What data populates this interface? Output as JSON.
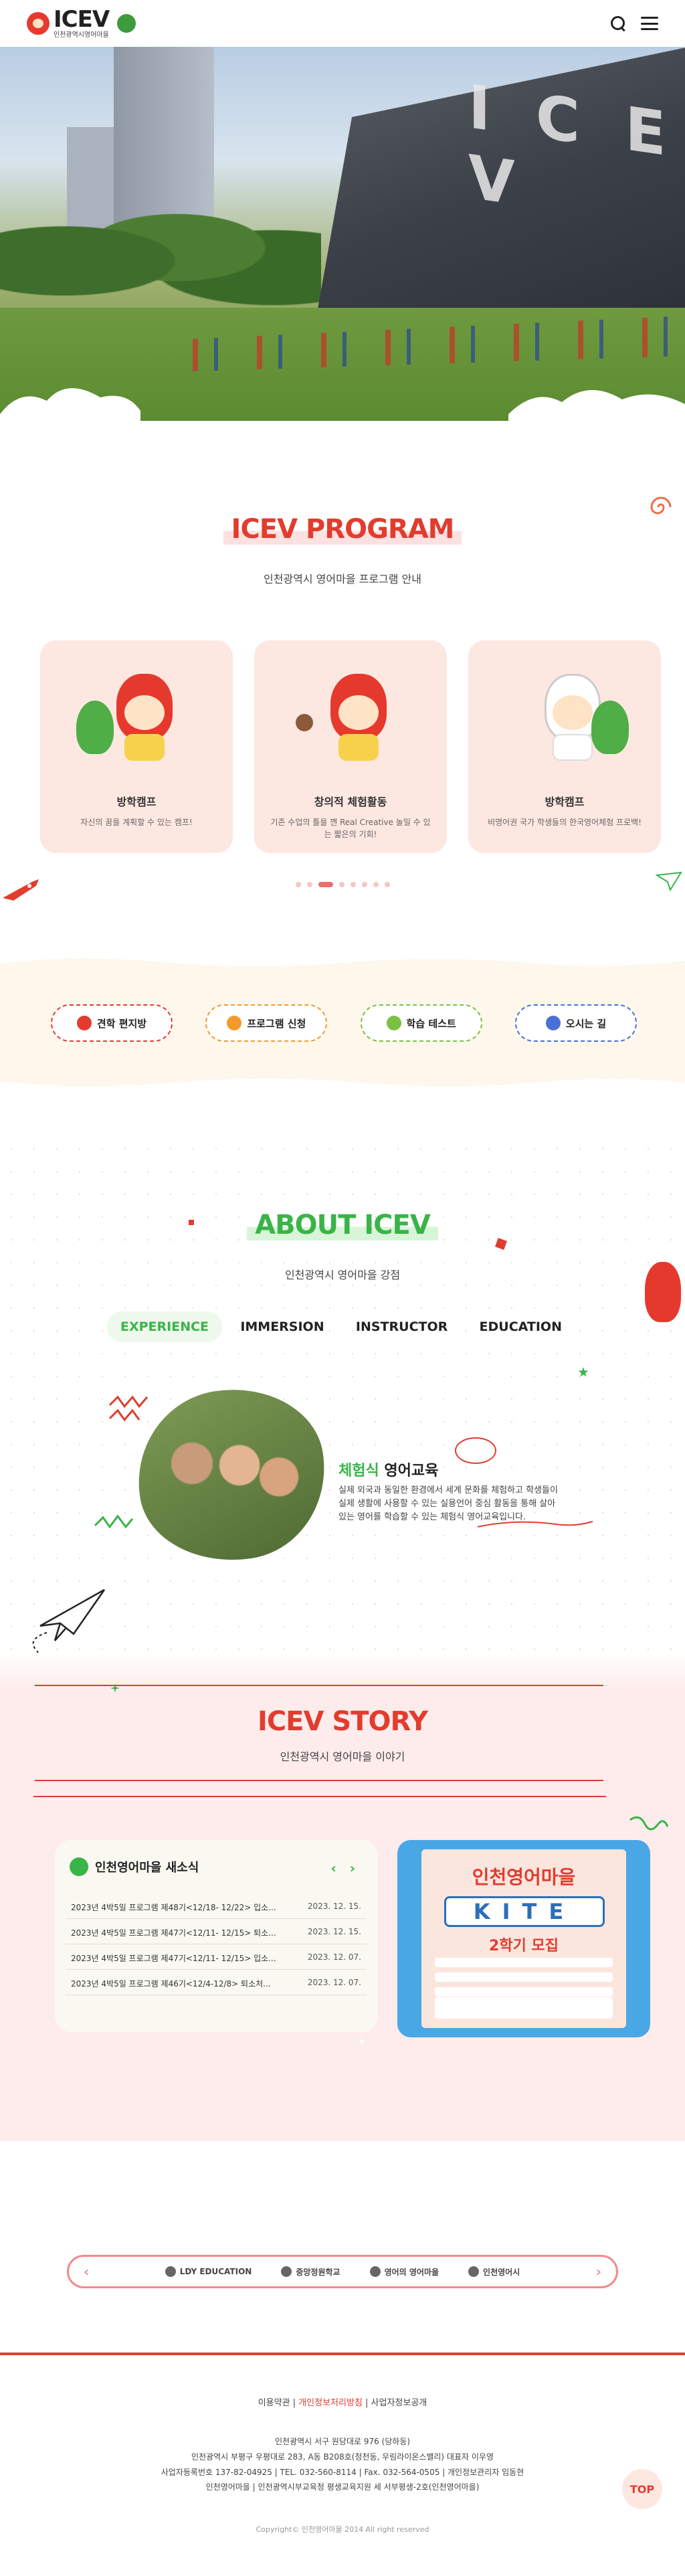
{
  "header": {
    "logo_word": "ICEV",
    "logo_sub": "인천광역시영어마을",
    "icons": [
      "search-icon",
      "menu-icon"
    ]
  },
  "hero": {
    "building_sign": "I C E V"
  },
  "program": {
    "title": "ICEV PROGRAM",
    "subtitle": "인천광역시 영어마을 프로그램 안내",
    "cards": [
      {
        "title": "방학캠프",
        "desc": "자신의 꿈을 계획할 수 있는 캠프!"
      },
      {
        "title": "창의적 체험활동",
        "desc": "기존 수업의 틀을 깬 Real Creative 놀일 수 있는 짧은의 기회!"
      },
      {
        "title": "방학캠프",
        "desc": "비영어권 국가 학생들의 한국영어체험 프로백!"
      }
    ],
    "dot_count": 8,
    "active_dot": 2
  },
  "quick_links": [
    {
      "label": "견학 편지방",
      "color": "#e23c2f"
    },
    {
      "label": "프로그램 신청",
      "color": "#f39a2b"
    },
    {
      "label": "학습 테스트",
      "color": "#7ac143"
    },
    {
      "label": "오시는 길",
      "color": "#4a6fd6"
    }
  ],
  "about": {
    "title": "ABOUT ICEV",
    "subtitle": "인천광역시 영어마을 강점",
    "tabs": [
      "EXPERIENCE",
      "IMMERSION",
      "INSTRUCTOR",
      "EDUCATION"
    ],
    "active_tab": 0,
    "headline_em": "체험식",
    "headline_rest": " 영어교육",
    "body": "실제 외국과 동일한 환경에서 세계 문화를 체험하고 학생들이 실제 생활에 사용할 수 있는 실용언어 중심 활동을 통해 살아있는 영어를 학습할 수 있는 체험식 영어교육입니다."
  },
  "story": {
    "title": "ICEV STORY",
    "subtitle": "인천광역시 영어마을 이야기",
    "news_title": "인천영어마을 새소식",
    "news": [
      {
        "title": "2023년 4박5일 프로그램 제48기<12/18- 12/22> 입소...",
        "date": "2023. 12. 15."
      },
      {
        "title": "2023년 4박5일 프로그램 제47기<12/11- 12/15> 퇴소...",
        "date": "2023. 12. 15."
      },
      {
        "title": "2023년 4박5일 프로그램 제47기<12/11- 12/15> 입소...",
        "date": "2023. 12. 07."
      },
      {
        "title": "2023년 4박5일 프로그램 제46기<12/4-12/8> 퇴소처...",
        "date": "2023. 12. 07."
      }
    ],
    "poster": {
      "tag": "KITE 모집",
      "title": "인천영어마을",
      "kite": "KITE",
      "sub": "2학기 모집"
    }
  },
  "partners": [
    "LDY EDUCATION",
    "중앙정원학교",
    "영어의 영어마을",
    "인천영어시"
  ],
  "footer": {
    "links": [
      {
        "label": "이용약관",
        "hot": false
      },
      {
        "label": "개인정보처리방침",
        "hot": true
      },
      {
        "label": "사업자정보공개",
        "hot": false
      }
    ],
    "info": [
      "인천광역시 서구 원당대로 976 (당하동)",
      "인천광역시 부평구 우평대로 283, A동 B208호(청천동, 우림라이온스밸리) 대표자 이우영",
      "사업자등록번호 137-82-04925 | TEL. 032-560-8114 | Fax. 032-564-0505 | 개인정보관리자 임동현",
      "인천영어마을 | 인천광역시부교육청 평생교육지원 세 서부평생-2호(인천영어마을)"
    ],
    "copyright": "Copyright© 인천영어마을 2014 All right reserved",
    "top_label": "TOP"
  }
}
